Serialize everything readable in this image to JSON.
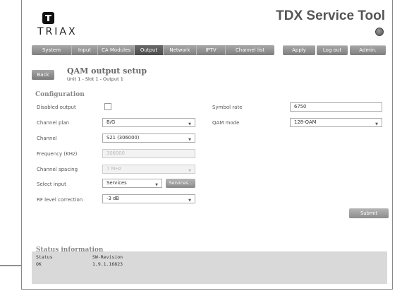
{
  "header": {
    "logo_text": "TRIAX",
    "app_title": "TDX Service Tool"
  },
  "nav": {
    "items": [
      {
        "label": "System",
        "active": false
      },
      {
        "label": "Input",
        "active": false
      },
      {
        "label": "CA Modules",
        "active": false
      },
      {
        "label": "Output",
        "active": true
      },
      {
        "label": "Network",
        "active": false
      },
      {
        "label": "IPTV",
        "active": false
      },
      {
        "label": "Channel list",
        "active": false
      }
    ],
    "apply": "Apply",
    "logout": "Log out",
    "admin": "Admin."
  },
  "page": {
    "back": "Back",
    "title": "QAM  output setup",
    "subtitle": "Unit 1 - Slot 1 - Output 1"
  },
  "config": {
    "section_title": "Configuration",
    "disabled_output": {
      "label": "Disabled output",
      "checked": false
    },
    "channel_plan": {
      "label": "Channel plan",
      "value": "B/G"
    },
    "channel": {
      "label": "Channel",
      "value": "S21 (306000)"
    },
    "frequency": {
      "label": "Frequency (KHz)",
      "value": "306000"
    },
    "channel_spacing": {
      "label": "Channel spacing",
      "value": "7 MHz"
    },
    "select_input": {
      "label": "Select input",
      "value": "Services",
      "button": "Services..."
    },
    "rf_level": {
      "label": "RF level correction",
      "value": "-3 dB"
    },
    "symbol_rate": {
      "label": "Symbol rate",
      "value": "6750"
    },
    "qam_mode": {
      "label": "QAM mode",
      "value": "128-QAM"
    },
    "submit": "Submit"
  },
  "status": {
    "section_title": "Status information",
    "headers": [
      "Status",
      "SW-Revision"
    ],
    "values": [
      "OK",
      "1.9.1.16823"
    ]
  }
}
